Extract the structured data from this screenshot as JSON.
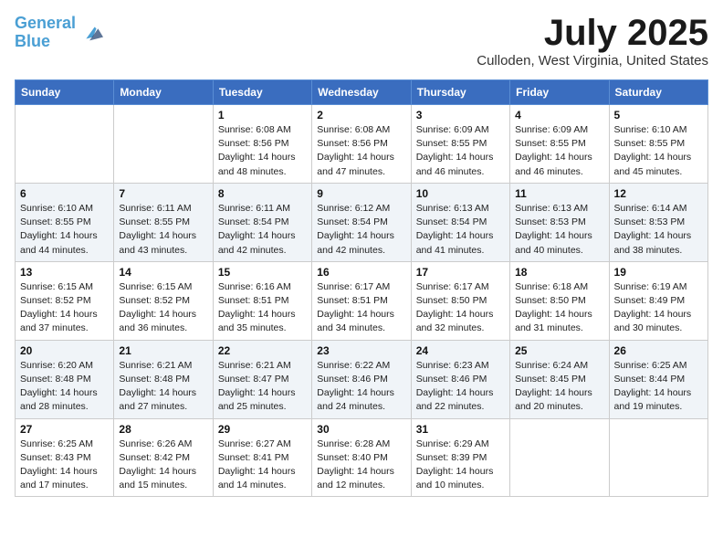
{
  "logo": {
    "line1": "General",
    "line2": "Blue"
  },
  "title": "July 2025",
  "location": "Culloden, West Virginia, United States",
  "weekdays": [
    "Sunday",
    "Monday",
    "Tuesday",
    "Wednesday",
    "Thursday",
    "Friday",
    "Saturday"
  ],
  "weeks": [
    [
      {
        "day": "",
        "info": ""
      },
      {
        "day": "",
        "info": ""
      },
      {
        "day": "1",
        "info": "Sunrise: 6:08 AM\nSunset: 8:56 PM\nDaylight: 14 hours\nand 48 minutes."
      },
      {
        "day": "2",
        "info": "Sunrise: 6:08 AM\nSunset: 8:56 PM\nDaylight: 14 hours\nand 47 minutes."
      },
      {
        "day": "3",
        "info": "Sunrise: 6:09 AM\nSunset: 8:55 PM\nDaylight: 14 hours\nand 46 minutes."
      },
      {
        "day": "4",
        "info": "Sunrise: 6:09 AM\nSunset: 8:55 PM\nDaylight: 14 hours\nand 46 minutes."
      },
      {
        "day": "5",
        "info": "Sunrise: 6:10 AM\nSunset: 8:55 PM\nDaylight: 14 hours\nand 45 minutes."
      }
    ],
    [
      {
        "day": "6",
        "info": "Sunrise: 6:10 AM\nSunset: 8:55 PM\nDaylight: 14 hours\nand 44 minutes."
      },
      {
        "day": "7",
        "info": "Sunrise: 6:11 AM\nSunset: 8:55 PM\nDaylight: 14 hours\nand 43 minutes."
      },
      {
        "day": "8",
        "info": "Sunrise: 6:11 AM\nSunset: 8:54 PM\nDaylight: 14 hours\nand 42 minutes."
      },
      {
        "day": "9",
        "info": "Sunrise: 6:12 AM\nSunset: 8:54 PM\nDaylight: 14 hours\nand 42 minutes."
      },
      {
        "day": "10",
        "info": "Sunrise: 6:13 AM\nSunset: 8:54 PM\nDaylight: 14 hours\nand 41 minutes."
      },
      {
        "day": "11",
        "info": "Sunrise: 6:13 AM\nSunset: 8:53 PM\nDaylight: 14 hours\nand 40 minutes."
      },
      {
        "day": "12",
        "info": "Sunrise: 6:14 AM\nSunset: 8:53 PM\nDaylight: 14 hours\nand 38 minutes."
      }
    ],
    [
      {
        "day": "13",
        "info": "Sunrise: 6:15 AM\nSunset: 8:52 PM\nDaylight: 14 hours\nand 37 minutes."
      },
      {
        "day": "14",
        "info": "Sunrise: 6:15 AM\nSunset: 8:52 PM\nDaylight: 14 hours\nand 36 minutes."
      },
      {
        "day": "15",
        "info": "Sunrise: 6:16 AM\nSunset: 8:51 PM\nDaylight: 14 hours\nand 35 minutes."
      },
      {
        "day": "16",
        "info": "Sunrise: 6:17 AM\nSunset: 8:51 PM\nDaylight: 14 hours\nand 34 minutes."
      },
      {
        "day": "17",
        "info": "Sunrise: 6:17 AM\nSunset: 8:50 PM\nDaylight: 14 hours\nand 32 minutes."
      },
      {
        "day": "18",
        "info": "Sunrise: 6:18 AM\nSunset: 8:50 PM\nDaylight: 14 hours\nand 31 minutes."
      },
      {
        "day": "19",
        "info": "Sunrise: 6:19 AM\nSunset: 8:49 PM\nDaylight: 14 hours\nand 30 minutes."
      }
    ],
    [
      {
        "day": "20",
        "info": "Sunrise: 6:20 AM\nSunset: 8:48 PM\nDaylight: 14 hours\nand 28 minutes."
      },
      {
        "day": "21",
        "info": "Sunrise: 6:21 AM\nSunset: 8:48 PM\nDaylight: 14 hours\nand 27 minutes."
      },
      {
        "day": "22",
        "info": "Sunrise: 6:21 AM\nSunset: 8:47 PM\nDaylight: 14 hours\nand 25 minutes."
      },
      {
        "day": "23",
        "info": "Sunrise: 6:22 AM\nSunset: 8:46 PM\nDaylight: 14 hours\nand 24 minutes."
      },
      {
        "day": "24",
        "info": "Sunrise: 6:23 AM\nSunset: 8:46 PM\nDaylight: 14 hours\nand 22 minutes."
      },
      {
        "day": "25",
        "info": "Sunrise: 6:24 AM\nSunset: 8:45 PM\nDaylight: 14 hours\nand 20 minutes."
      },
      {
        "day": "26",
        "info": "Sunrise: 6:25 AM\nSunset: 8:44 PM\nDaylight: 14 hours\nand 19 minutes."
      }
    ],
    [
      {
        "day": "27",
        "info": "Sunrise: 6:25 AM\nSunset: 8:43 PM\nDaylight: 14 hours\nand 17 minutes."
      },
      {
        "day": "28",
        "info": "Sunrise: 6:26 AM\nSunset: 8:42 PM\nDaylight: 14 hours\nand 15 minutes."
      },
      {
        "day": "29",
        "info": "Sunrise: 6:27 AM\nSunset: 8:41 PM\nDaylight: 14 hours\nand 14 minutes."
      },
      {
        "day": "30",
        "info": "Sunrise: 6:28 AM\nSunset: 8:40 PM\nDaylight: 14 hours\nand 12 minutes."
      },
      {
        "day": "31",
        "info": "Sunrise: 6:29 AM\nSunset: 8:39 PM\nDaylight: 14 hours\nand 10 minutes."
      },
      {
        "day": "",
        "info": ""
      },
      {
        "day": "",
        "info": ""
      }
    ]
  ]
}
